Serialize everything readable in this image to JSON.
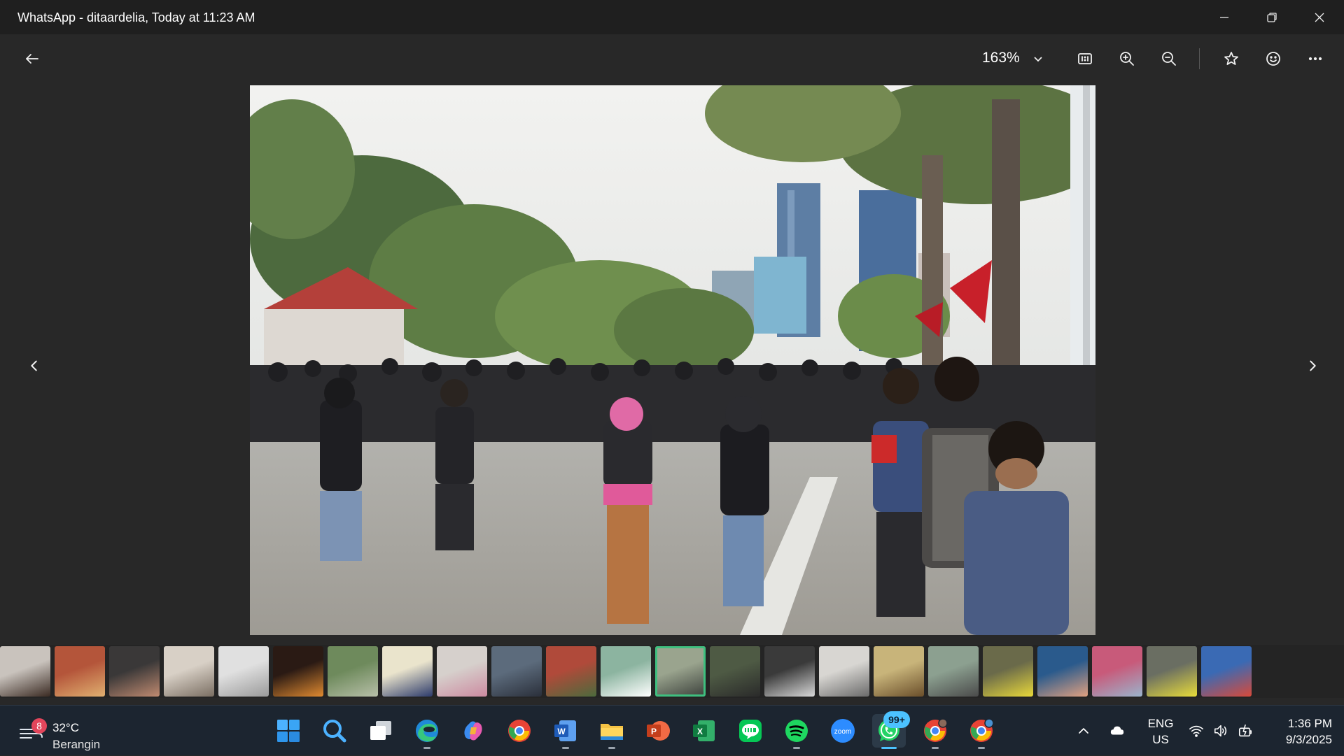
{
  "window": {
    "title": "WhatsApp - ditaardelia, Today at 11:23 AM",
    "controls": [
      "minimize-icon",
      "restore-icon",
      "close-icon"
    ]
  },
  "toolbar": {
    "zoom_level": "163%",
    "buttons": [
      "back-arrow-icon",
      "actual-size-icon",
      "zoom-in-icon",
      "zoom-out-icon",
      "star-icon",
      "emoji-icon",
      "more-icon"
    ]
  },
  "viewer": {
    "image_subject": "crowd-of-protesters-on-city-street",
    "prev_icon": "chevron-left-icon",
    "next_icon": "chevron-right-icon"
  },
  "filmstrip": {
    "selected_index": 12,
    "thumbs": [
      {
        "bg": "#c9c3bd",
        "fg": "#3a2a22"
      },
      {
        "bg": "#b4553a",
        "fg": "#e0b070"
      },
      {
        "bg": "#3a3838",
        "fg": "#c08a70"
      },
      {
        "bg": "#d8d0c6",
        "fg": "#7a6e62"
      },
      {
        "bg": "#e0e0e0",
        "fg": "#9a9a9a"
      },
      {
        "bg": "#2a1a14",
        "fg": "#e08a30"
      },
      {
        "bg": "#6e8a5c",
        "fg": "#b7bfa8"
      },
      {
        "bg": "#eae4cc",
        "fg": "#2c3a6a"
      },
      {
        "bg": "#d6d0cc",
        "fg": "#cc8aa0"
      },
      {
        "bg": "#5c6b7c",
        "fg": "#2a2f3a"
      },
      {
        "bg": "#b04a3a",
        "fg": "#4c6a3c"
      },
      {
        "bg": "#8cb4a0",
        "fg": "#ffffff"
      },
      {
        "bg": "#9aa48e",
        "fg": "#3a3f3a"
      },
      {
        "bg": "#4e5a44",
        "fg": "#2a2a2a"
      },
      {
        "bg": "#3a3a3a",
        "fg": "#d8d8d8"
      },
      {
        "bg": "#d8d6d2",
        "fg": "#6a6a6a"
      },
      {
        "bg": "#c8b47a",
        "fg": "#6a4e2a"
      },
      {
        "bg": "#8ca090",
        "fg": "#4a4a4a"
      },
      {
        "bg": "#6a6a4a",
        "fg": "#e8d83a"
      },
      {
        "bg": "#2a5a8c",
        "fg": "#e0a080"
      },
      {
        "bg": "#c85a7a",
        "fg": "#9ab4cc"
      },
      {
        "bg": "#6a6e62",
        "fg": "#e8dc3a"
      },
      {
        "bg": "#3a6ab4",
        "fg": "#d84a3a"
      }
    ]
  },
  "taskbar": {
    "weather": {
      "badge": "8",
      "temp": "32°C",
      "condition": "Berangin"
    },
    "apps": [
      {
        "name": "start-icon"
      },
      {
        "name": "search-icon"
      },
      {
        "name": "task-view-icon"
      },
      {
        "name": "edge-icon"
      },
      {
        "name": "copilot-icon"
      },
      {
        "name": "chrome-icon"
      },
      {
        "name": "word-icon"
      },
      {
        "name": "file-explorer-icon"
      },
      {
        "name": "powerpoint-icon"
      },
      {
        "name": "excel-icon"
      },
      {
        "name": "line-icon"
      },
      {
        "name": "spotify-icon"
      },
      {
        "name": "zoom-icon",
        "label": "zoom"
      },
      {
        "name": "whatsapp-icon",
        "badge": "99+"
      },
      {
        "name": "chrome-profile-icon"
      },
      {
        "name": "chrome-profile-2-icon"
      }
    ],
    "tray": {
      "language_top": "ENG",
      "language_bottom": "US",
      "time": "1:36 PM",
      "date": "9/3/2025"
    }
  }
}
